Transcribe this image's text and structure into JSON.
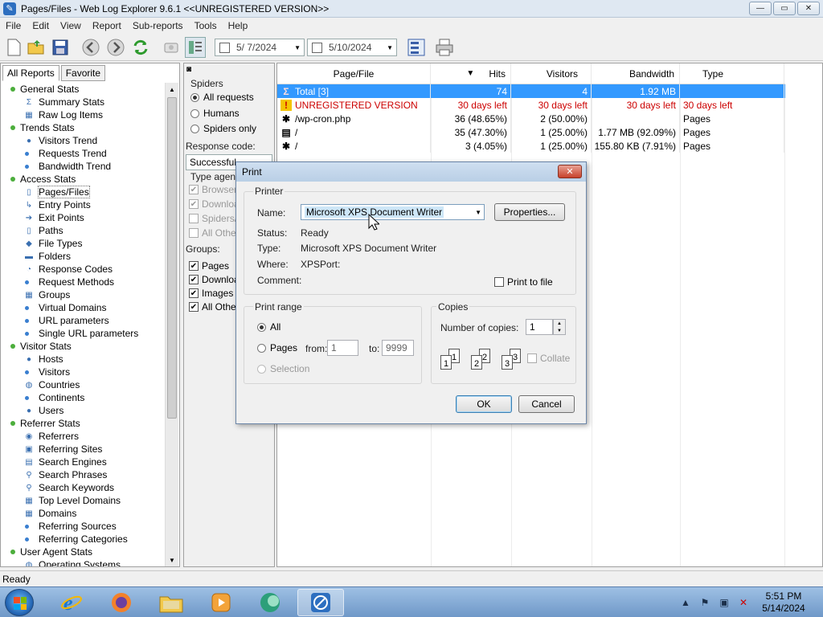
{
  "window": {
    "title": "Pages/Files - Web Log Explorer 9.6.1 <<UNREGISTERED VERSION>>",
    "min": "—",
    "max": "▭",
    "close": "✕"
  },
  "menu": [
    "File",
    "Edit",
    "View",
    "Report",
    "Sub-reports",
    "Tools",
    "Help"
  ],
  "toolbar": {
    "date_from": "5/ 7/2024",
    "date_to": "5/10/2024"
  },
  "left_tabs": [
    "All Reports",
    "Favorite"
  ],
  "tree": [
    {
      "label": "General Stats",
      "level": 0
    },
    {
      "label": "Summary Stats",
      "level": 1,
      "icon": "sigma-icon",
      "glyph": "Σ"
    },
    {
      "label": "Raw Log Items",
      "level": 1,
      "icon": "table-icon",
      "glyph": "▦"
    },
    {
      "label": "Trends Stats",
      "level": 0
    },
    {
      "label": "Visitors Trend",
      "level": 1,
      "icon": "user-icon",
      "glyph": "●"
    },
    {
      "label": "Requests Trend",
      "level": 1,
      "icon": "dot-icon"
    },
    {
      "label": "Bandwidth Trend",
      "level": 1,
      "icon": "dot-icon"
    },
    {
      "label": "Access Stats",
      "level": 0
    },
    {
      "label": "Pages/Files",
      "level": 1,
      "icon": "page-icon",
      "glyph": "▯"
    },
    {
      "label": "Entry Points",
      "level": 1,
      "icon": "entry-icon",
      "glyph": "↳"
    },
    {
      "label": "Exit Points",
      "level": 1,
      "icon": "exit-icon",
      "glyph": "➔"
    },
    {
      "label": "Paths",
      "level": 1,
      "icon": "page-icon",
      "glyph": "▯"
    },
    {
      "label": "File Types",
      "level": 1,
      "icon": "filetypes-icon",
      "glyph": "◆"
    },
    {
      "label": "Folders",
      "level": 1,
      "icon": "folder-icon",
      "glyph": "▬"
    },
    {
      "label": "Response Codes",
      "level": 1,
      "icon": "response-icon",
      "glyph": "◔"
    },
    {
      "label": "Request Methods",
      "level": 1,
      "icon": "dot-icon"
    },
    {
      "label": "Groups",
      "level": 1,
      "icon": "groups-icon",
      "glyph": "▦"
    },
    {
      "label": "Virtual Domains",
      "level": 1,
      "icon": "dot-icon"
    },
    {
      "label": "URL parameters",
      "level": 1,
      "icon": "dot-icon"
    },
    {
      "label": "Single URL parameters",
      "level": 1,
      "icon": "dot-icon"
    },
    {
      "label": "Visitor Stats",
      "level": 0
    },
    {
      "label": "Hosts",
      "level": 1,
      "icon": "user-icon",
      "glyph": "●"
    },
    {
      "label": "Visitors",
      "level": 1,
      "icon": "dot-icon"
    },
    {
      "label": "Countries",
      "level": 1,
      "icon": "globe-icon",
      "glyph": "◍"
    },
    {
      "label": "Continents",
      "level": 1,
      "icon": "dot-icon"
    },
    {
      "label": "Users",
      "level": 1,
      "icon": "user-icon",
      "glyph": "●"
    },
    {
      "label": "Referrer Stats",
      "level": 0
    },
    {
      "label": "Referrers",
      "level": 1,
      "icon": "referrer-icon",
      "glyph": "◉"
    },
    {
      "label": "Referring Sites",
      "level": 1,
      "icon": "sites-icon",
      "glyph": "▣"
    },
    {
      "label": "Search Engines",
      "level": 1,
      "icon": "engine-icon",
      "glyph": "▤"
    },
    {
      "label": "Search Phrases",
      "level": 1,
      "icon": "magnifier-icon",
      "glyph": "⚲"
    },
    {
      "label": "Search Keywords",
      "level": 1,
      "icon": "magnifier-icon",
      "glyph": "⚲"
    },
    {
      "label": "Top Level Domains",
      "level": 1,
      "icon": "domains-icon",
      "glyph": "▦"
    },
    {
      "label": "Domains",
      "level": 1,
      "icon": "domains-icon",
      "glyph": "▦"
    },
    {
      "label": "Referring Sources",
      "level": 1,
      "icon": "dot-icon"
    },
    {
      "label": "Referring Categories",
      "level": 1,
      "icon": "dot-icon"
    },
    {
      "label": "User Agent Stats",
      "level": 0
    },
    {
      "label": "Operating Systems",
      "level": 1,
      "icon": "os-icon",
      "glyph": "◍"
    }
  ],
  "filters": {
    "spiders_label": "Spiders",
    "spiders_options": [
      "All requests",
      "Humans",
      "Spiders only"
    ],
    "response_label": "Response code:",
    "response_value": "Successful",
    "type_agent_label": "Type agent",
    "agent_items": [
      "Browsers",
      "Downloa",
      "Spiders/",
      "All Other"
    ],
    "groups_label": "Groups:",
    "group_items": [
      "Pages",
      "Downloa",
      "Images",
      "All Others"
    ]
  },
  "grid": {
    "columns": [
      "Page/File",
      "Hits",
      "Visitors",
      "Bandwidth",
      "Type"
    ],
    "rows": [
      {
        "page": "Total [3]",
        "hits": "74",
        "visitors": "4",
        "bandwidth": "1.92 MB",
        "type": "",
        "icon": "sigma-icon",
        "glyph": "Σ"
      },
      {
        "page": "UNREGISTERED VERSION",
        "hits": "30 days left",
        "visitors": "30 days left",
        "bandwidth": "30 days left",
        "type": "30 days left",
        "icon": "warning-icon",
        "glyph": "!"
      },
      {
        "page": "/wp-cron.php",
        "hits": "36 (48.65%)",
        "visitors": "2 (50.00%)",
        "bandwidth": "",
        "type": "Pages",
        "icon": "spider-icon",
        "glyph": "✱"
      },
      {
        "page": "/",
        "hits": "35 (47.30%)",
        "visitors": "1 (25.00%)",
        "bandwidth": "1.77 MB (92.09%)",
        "type": "Pages",
        "icon": "page-icon",
        "glyph": "▤"
      },
      {
        "page": "/",
        "hits": "3 (4.05%)",
        "visitors": "1 (25.00%)",
        "bandwidth": "155.80 KB (7.91%)",
        "type": "Pages",
        "icon": "spider-icon",
        "glyph": "✱"
      }
    ]
  },
  "status": "Ready",
  "print_dialog": {
    "title": "Print",
    "printer_group": "Printer",
    "name_label": "Name:",
    "name_value": "Microsoft XPS Document Writer",
    "properties_button": "Properties...",
    "status_label": "Status:",
    "status_value": "Ready",
    "type_label": "Type:",
    "type_value": "Microsoft XPS Document Writer",
    "where_label": "Where:",
    "where_value": "XPSPort:",
    "comment_label": "Comment:",
    "print_to_file": "Print to file",
    "range_group": "Print range",
    "range_all": "All",
    "range_pages": "Pages",
    "from_label": "from:",
    "from_value": "1",
    "to_label": "to:",
    "to_value": "9999",
    "range_selection": "Selection",
    "copies_group": "Copies",
    "copies_label": "Number of copies:",
    "copies_value": "1",
    "collate_label": "Collate",
    "ok": "OK",
    "cancel": "Cancel"
  },
  "taskbar": {
    "time": "5:51 PM",
    "date": "5/14/2024"
  }
}
